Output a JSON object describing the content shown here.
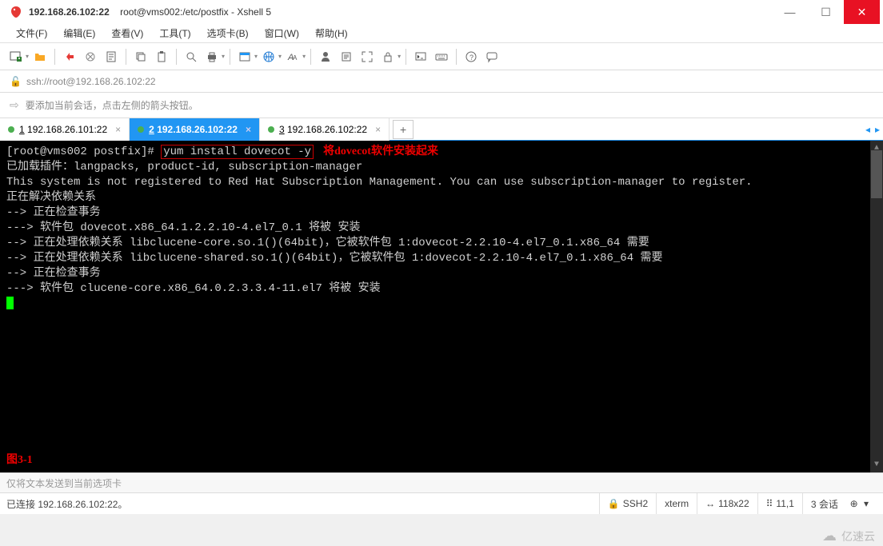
{
  "title": {
    "host": "192.168.26.102:22",
    "full": "root@vms002:/etc/postfix - Xshell 5"
  },
  "menu": {
    "file": "文件(F)",
    "edit": "编辑(E)",
    "view": "查看(V)",
    "tools": "工具(T)",
    "tabs": "选项卡(B)",
    "window": "窗口(W)",
    "help": "帮助(H)"
  },
  "address": {
    "url": "ssh://root@192.168.26.102:22"
  },
  "hint": {
    "text": "要添加当前会话，点击左侧的箭头按钮。"
  },
  "tabs": [
    {
      "num": "1",
      "label": "192.168.26.101:22",
      "active": false
    },
    {
      "num": "2",
      "label": "192.168.26.102:22",
      "active": true
    },
    {
      "num": "3",
      "label": "192.168.26.102:22",
      "active": false
    }
  ],
  "terminal": {
    "prompt": "[root@vms002 postfix]# ",
    "command": "yum install dovecot -y",
    "annotation": "将dovecot软件安装起来",
    "lines": [
      "已加载插件：langpacks, product-id, subscription-manager",
      "This system is not registered to Red Hat Subscription Management. You can use subscription-manager to register.",
      "正在解决依赖关系",
      "--> 正在检查事务",
      "---> 软件包 dovecot.x86_64.1.2.2.10-4.el7_0.1 将被 安装",
      "--> 正在处理依赖关系 libclucene-core.so.1()(64bit)，它被软件包 1:dovecot-2.2.10-4.el7_0.1.x86_64 需要",
      "--> 正在处理依赖关系 libclucene-shared.so.1()(64bit)，它被软件包 1:dovecot-2.2.10-4.el7_0.1.x86_64 需要",
      "--> 正在检查事务",
      "---> 软件包 clucene-core.x86_64.0.2.3.3.4-11.el7 将被 安装"
    ],
    "figure_label": "图3-1"
  },
  "sendline": {
    "placeholder": "仅将文本发送到当前选项卡"
  },
  "status": {
    "connected": "已连接 192.168.26.102:22。",
    "protocol": "SSH2",
    "term": "xterm",
    "size": "118x22",
    "cursor": "11,1",
    "sessions": "3 会话"
  },
  "watermark": {
    "text": "亿速云"
  }
}
